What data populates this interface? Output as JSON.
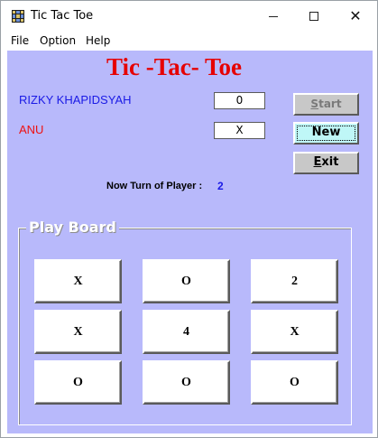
{
  "window": {
    "title": "Tic Tac Toe",
    "close_glyph": "✕"
  },
  "menu": {
    "items": [
      "File",
      "Option",
      "Help"
    ]
  },
  "game": {
    "title": "Tic -Tac- Toe"
  },
  "players": [
    {
      "name": "RIZKY KHAPIDSYAH",
      "mark": "0",
      "color": "#1a1ae6"
    },
    {
      "name": "ANU",
      "mark": "X",
      "color": "#ee1111"
    }
  ],
  "buttons": {
    "start": "Start",
    "new": "New",
    "exit": "Exit"
  },
  "turn": {
    "label": "Now Turn of Player :",
    "value": "2"
  },
  "board": {
    "legend": "Play Board",
    "cells": [
      [
        "X",
        "O",
        "2"
      ],
      [
        "X",
        "4",
        "X"
      ],
      [
        "O",
        "O",
        "O"
      ]
    ]
  },
  "colors": {
    "client_background": "#b8b9fb",
    "title_red": "#e60000",
    "new_button": "#bff7f7"
  }
}
